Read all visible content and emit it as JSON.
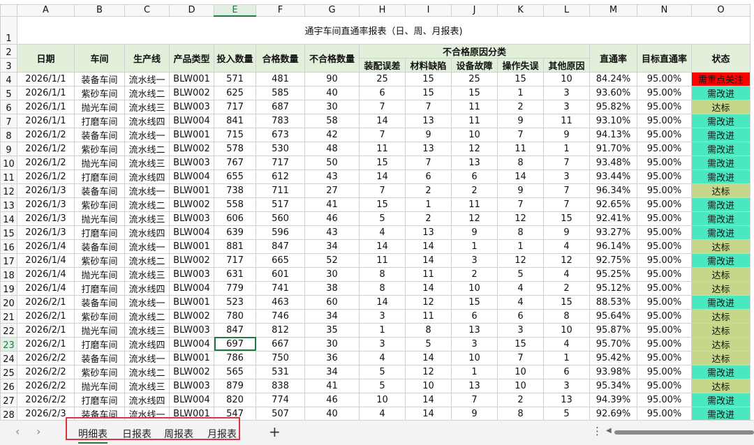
{
  "title": "通宇车间直通率报表（日、周、月报表)",
  "columns": [
    "A",
    "B",
    "C",
    "D",
    "E",
    "F",
    "G",
    "H",
    "I",
    "J",
    "K",
    "L",
    "M",
    "N",
    "O"
  ],
  "row_numbers": [
    1,
    2,
    3,
    4,
    5,
    6,
    7,
    8,
    9,
    10,
    11,
    12,
    13,
    14,
    15,
    16,
    17,
    18,
    19,
    20,
    21,
    22,
    23,
    24,
    25,
    26,
    27,
    28
  ],
  "headers": {
    "date": "日期",
    "workshop": "车间",
    "line": "生产线",
    "product": "产品类型",
    "input": "投入数量",
    "pass": "合格数量",
    "fail": "不合格数量",
    "reason_group": "不合格原因分类",
    "reasons": [
      "装配误差",
      "材料缺陷",
      "设备故障",
      "操作失误",
      "其他原因"
    ],
    "fpy": "直通率",
    "target": "目标直通率",
    "status": "状态"
  },
  "status_colors": {
    "需重点关注": "#ff0000",
    "需改进": "#49e8c0",
    "达标": "#c6d68a"
  },
  "rows": [
    [
      "2026/1/1",
      "装备车间",
      "流水线一",
      "BLW001",
      "571",
      "481",
      "90",
      "25",
      "15",
      "25",
      "15",
      "10",
      "84.24%",
      "95.00%",
      "需重点关注"
    ],
    [
      "2026/1/1",
      "紫砂车间",
      "流水线二",
      "BLW002",
      "625",
      "585",
      "40",
      "6",
      "15",
      "15",
      "1",
      "3",
      "93.60%",
      "95.00%",
      "需改进"
    ],
    [
      "2026/1/1",
      "抛光车间",
      "流水线三",
      "BLW003",
      "717",
      "687",
      "30",
      "7",
      "7",
      "11",
      "2",
      "3",
      "95.82%",
      "95.00%",
      "达标"
    ],
    [
      "2026/1/1",
      "打磨车间",
      "流水线四",
      "BLW004",
      "841",
      "783",
      "58",
      "14",
      "13",
      "11",
      "9",
      "11",
      "93.10%",
      "95.00%",
      "需改进"
    ],
    [
      "2026/1/2",
      "装备车间",
      "流水线一",
      "BLW001",
      "715",
      "673",
      "42",
      "7",
      "9",
      "10",
      "7",
      "9",
      "94.13%",
      "95.00%",
      "需改进"
    ],
    [
      "2026/1/2",
      "紫砂车间",
      "流水线二",
      "BLW002",
      "578",
      "530",
      "48",
      "11",
      "13",
      "12",
      "11",
      "1",
      "91.70%",
      "95.00%",
      "需改进"
    ],
    [
      "2026/1/2",
      "抛光车间",
      "流水线三",
      "BLW003",
      "767",
      "717",
      "50",
      "15",
      "7",
      "13",
      "8",
      "7",
      "93.48%",
      "95.00%",
      "需改进"
    ],
    [
      "2026/1/2",
      "打磨车间",
      "流水线四",
      "BLW004",
      "655",
      "612",
      "43",
      "14",
      "6",
      "6",
      "14",
      "3",
      "93.44%",
      "95.00%",
      "需改进"
    ],
    [
      "2026/1/3",
      "装备车间",
      "流水线一",
      "BLW001",
      "738",
      "711",
      "27",
      "7",
      "2",
      "2",
      "9",
      "7",
      "96.34%",
      "95.00%",
      "达标"
    ],
    [
      "2026/1/3",
      "紫砂车间",
      "流水线二",
      "BLW002",
      "558",
      "517",
      "41",
      "15",
      "1",
      "11",
      "7",
      "7",
      "92.65%",
      "95.00%",
      "需改进"
    ],
    [
      "2026/1/3",
      "抛光车间",
      "流水线三",
      "BLW003",
      "606",
      "560",
      "46",
      "5",
      "2",
      "12",
      "12",
      "15",
      "92.41%",
      "95.00%",
      "需改进"
    ],
    [
      "2026/1/3",
      "打磨车间",
      "流水线四",
      "BLW004",
      "639",
      "596",
      "43",
      "4",
      "13",
      "9",
      "8",
      "9",
      "93.27%",
      "95.00%",
      "需改进"
    ],
    [
      "2026/1/4",
      "装备车间",
      "流水线一",
      "BLW001",
      "881",
      "847",
      "34",
      "14",
      "14",
      "1",
      "1",
      "4",
      "96.14%",
      "95.00%",
      "达标"
    ],
    [
      "2026/1/4",
      "紫砂车间",
      "流水线二",
      "BLW002",
      "717",
      "665",
      "52",
      "11",
      "14",
      "3",
      "12",
      "12",
      "92.75%",
      "95.00%",
      "需改进"
    ],
    [
      "2026/1/4",
      "抛光车间",
      "流水线三",
      "BLW003",
      "631",
      "601",
      "30",
      "8",
      "11",
      "2",
      "5",
      "4",
      "95.25%",
      "95.00%",
      "达标"
    ],
    [
      "2026/1/4",
      "打磨车间",
      "流水线四",
      "BLW004",
      "779",
      "741",
      "38",
      "8",
      "14",
      "10",
      "4",
      "2",
      "95.12%",
      "95.00%",
      "达标"
    ],
    [
      "2026/2/1",
      "装备车间",
      "流水线一",
      "BLW001",
      "523",
      "463",
      "60",
      "14",
      "12",
      "15",
      "4",
      "15",
      "88.53%",
      "95.00%",
      "需改进"
    ],
    [
      "2026/2/1",
      "紫砂车间",
      "流水线二",
      "BLW002",
      "780",
      "746",
      "34",
      "3",
      "11",
      "6",
      "6",
      "8",
      "95.64%",
      "95.00%",
      "达标"
    ],
    [
      "2026/2/1",
      "抛光车间",
      "流水线三",
      "BLW003",
      "847",
      "812",
      "35",
      "1",
      "8",
      "13",
      "3",
      "10",
      "95.87%",
      "95.00%",
      "达标"
    ],
    [
      "2026/2/1",
      "打磨车间",
      "流水线四",
      "BLW004",
      "697",
      "667",
      "30",
      "3",
      "5",
      "3",
      "15",
      "4",
      "95.70%",
      "95.00%",
      "达标"
    ],
    [
      "2026/2/2",
      "装备车间",
      "流水线一",
      "BLW001",
      "786",
      "750",
      "36",
      "4",
      "14",
      "10",
      "7",
      "1",
      "95.42%",
      "95.00%",
      "达标"
    ],
    [
      "2026/2/2",
      "紫砂车间",
      "流水线二",
      "BLW002",
      "565",
      "531",
      "34",
      "5",
      "12",
      "1",
      "10",
      "6",
      "93.98%",
      "95.00%",
      "需改进"
    ],
    [
      "2026/2/2",
      "抛光车间",
      "流水线三",
      "BLW003",
      "879",
      "838",
      "41",
      "5",
      "10",
      "13",
      "10",
      "3",
      "95.34%",
      "95.00%",
      "达标"
    ],
    [
      "2026/2/2",
      "打磨车间",
      "流水线四",
      "BLW004",
      "820",
      "774",
      "46",
      "10",
      "14",
      "7",
      "2",
      "13",
      "94.39%",
      "95.00%",
      "需改进"
    ],
    [
      "2026/2/3",
      "装备车间",
      "流水线一",
      "BLW001",
      "547",
      "507",
      "40",
      "4",
      "14",
      "9",
      "8",
      "5",
      "92.69%",
      "95.00%",
      "需改进"
    ]
  ],
  "selected_cell": {
    "column": "E",
    "row": 23
  },
  "tabs": [
    "明细表",
    "日报表",
    "周报表",
    "月报表"
  ],
  "active_tab": "明细表",
  "add_sheet": "+",
  "more_icon": "⋮",
  "nav": {
    "prev": "‹",
    "next": "›"
  }
}
